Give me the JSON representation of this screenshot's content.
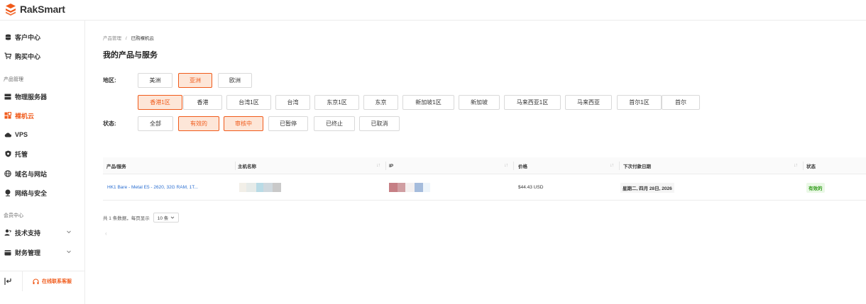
{
  "brand": {
    "name": "RakSmart",
    "accent": "#f05a1a"
  },
  "sidebar": {
    "top_items": [
      {
        "label": "客户中心",
        "icon": "database-icon"
      },
      {
        "label": "购买中心",
        "icon": "cart-icon"
      }
    ],
    "section_products": "产品管理",
    "product_items": [
      {
        "label": "物理服务器",
        "icon": "server-icon"
      },
      {
        "label": "裸机云",
        "icon": "grid-icon",
        "active": true
      },
      {
        "label": "VPS",
        "icon": "cloud-icon"
      },
      {
        "label": "托管",
        "icon": "shield-icon"
      },
      {
        "label": "域名与网站",
        "icon": "globe-icon"
      },
      {
        "label": "网络与安全",
        "icon": "network-icon"
      }
    ],
    "section_member": "会员中心",
    "member_items": [
      {
        "label": "技术支持",
        "icon": "support-icon"
      },
      {
        "label": "财务管理",
        "icon": "wallet-icon"
      }
    ],
    "support_label": "在线联系客服"
  },
  "breadcrumb": {
    "parent": "产品管理",
    "separator": "/",
    "current": "已购裸机云"
  },
  "page_title": "我的产品与服务",
  "filters": {
    "region_label": "地区:",
    "regions": [
      {
        "label": "美洲",
        "selected": false
      },
      {
        "label": "亚洲",
        "selected": true
      },
      {
        "label": "欧洲",
        "selected": false
      }
    ],
    "zones": [
      {
        "label": "香港1区",
        "selected": true
      },
      {
        "label": "香港",
        "selected": false
      },
      {
        "label": "台湾1区",
        "selected": false
      },
      {
        "label": "台湾",
        "selected": false
      },
      {
        "label": "东京1区",
        "selected": false
      },
      {
        "label": "东京",
        "selected": false
      },
      {
        "label": "新加坡1区",
        "selected": false
      },
      {
        "label": "新加坡",
        "selected": false
      },
      {
        "label": "马来西亚1区",
        "selected": false
      },
      {
        "label": "马来西亚",
        "selected": false
      },
      {
        "label": "首尔1区",
        "selected": false
      },
      {
        "label": "首尔",
        "selected": false
      }
    ],
    "status_label": "状态:",
    "statuses": [
      {
        "label": "全部",
        "selected": false
      },
      {
        "label": "有效的",
        "selected": true
      },
      {
        "label": "审核中",
        "selected": true
      },
      {
        "label": "已暂停",
        "selected": false
      },
      {
        "label": "已终止",
        "selected": false
      },
      {
        "label": "已取消",
        "selected": false
      }
    ]
  },
  "table": {
    "columns": [
      "产品/服务",
      "主机名称",
      "IP",
      "价格",
      "下次付款日期",
      "状态"
    ],
    "rows": [
      {
        "product": "HK1 Bare - Metal E5 - 2620, 32G RAM, 1T...",
        "price": "$44.43 USD",
        "next_due": "星期二, 四月 28日, 2026",
        "status": "有效的"
      }
    ]
  },
  "pagination": {
    "summary": "共 1 条数据，每页显示",
    "page_size": "10 条"
  },
  "colors": {
    "active_bg": "#fde6d8",
    "link": "#2a6ed1",
    "status_green": "#2e9b17"
  }
}
